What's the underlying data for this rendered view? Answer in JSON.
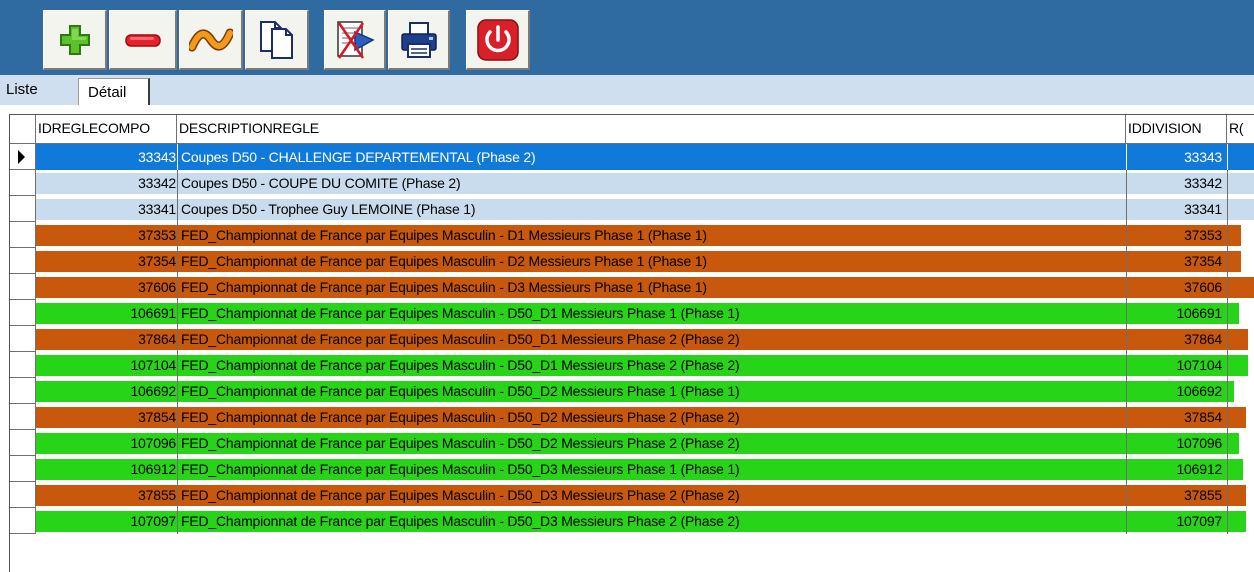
{
  "toolbar": {
    "buttons": [
      {
        "name": "add-button",
        "icon": "plus-icon"
      },
      {
        "name": "remove-button",
        "icon": "minus-icon"
      },
      {
        "name": "edit-button",
        "icon": "wave-icon"
      },
      {
        "name": "copy-button",
        "icon": "copy-pages-icon"
      },
      {
        "name": "export-button",
        "icon": "export-icon"
      },
      {
        "name": "print-button",
        "icon": "printer-icon"
      },
      {
        "name": "quit-button",
        "icon": "power-icon"
      }
    ]
  },
  "tabs": {
    "liste": "Liste",
    "detail": "Détail"
  },
  "grid": {
    "headers": {
      "id": "IDREGLECOMPO",
      "desc": "DESCRIPTIONREGLE",
      "division": "IDDIVISION",
      "extra": "R("
    },
    "rows": [
      {
        "id": "33343",
        "desc": "Coupes D50 - CHALLENGE DEPARTEMENTAL (Phase 2)",
        "division": "33343",
        "status": "selected"
      },
      {
        "id": "33342",
        "desc": "Coupes D50 - COUPE DU COMITE (Phase 2)",
        "division": "33342",
        "status": "none"
      },
      {
        "id": "33341",
        "desc": "Coupes D50 - Trophee Guy LEMOINE (Phase 1)",
        "division": "33341",
        "status": "none"
      },
      {
        "id": "37353",
        "desc": "FED_Championnat de France par Equipes Masculin - D1 Messieurs Phase 1 (Phase 1)",
        "division": "37353",
        "status": "orange"
      },
      {
        "id": "37354",
        "desc": "FED_Championnat de France par Equipes Masculin - D2 Messieurs Phase 1 (Phase 1)",
        "division": "37354",
        "status": "orange"
      },
      {
        "id": "37606",
        "desc": "FED_Championnat de France par Equipes Masculin - D3 Messieurs Phase 1 (Phase 1)",
        "division": "37606",
        "status": "orange"
      },
      {
        "id": "106691",
        "desc": "FED_Championnat de France par Equipes Masculin - D50_D1 Messieurs Phase 1 (Phase 1)",
        "division": "106691",
        "status": "green"
      },
      {
        "id": "37864",
        "desc": "FED_Championnat de France par Equipes Masculin - D50_D1 Messieurs Phase 2 (Phase 2)",
        "division": "37864",
        "status": "orange"
      },
      {
        "id": "107104",
        "desc": "FED_Championnat de France par Equipes Masculin - D50_D1 Messieurs Phase 2 (Phase 2)",
        "division": "107104",
        "status": "green"
      },
      {
        "id": "106692",
        "desc": "FED_Championnat de France par Equipes Masculin - D50_D2 Messieurs Phase 1 (Phase 1)",
        "division": "106692",
        "status": "green"
      },
      {
        "id": "37854",
        "desc": "FED_Championnat de France par Equipes Masculin - D50_D2 Messieurs Phase 2 (Phase 2)",
        "division": "37854",
        "status": "orange"
      },
      {
        "id": "107096",
        "desc": "FED_Championnat de France par Equipes Masculin - D50_D2 Messieurs Phase 2 (Phase 2)",
        "division": "107096",
        "status": "green"
      },
      {
        "id": "106912",
        "desc": "FED_Championnat de France par Equipes Masculin - D50_D3 Messieurs Phase 1 (Phase 1)",
        "division": "106912",
        "status": "green"
      },
      {
        "id": "37855",
        "desc": "FED_Championnat de France par Equipes Masculin - D50_D3 Messieurs Phase 2 (Phase 2)",
        "division": "37855",
        "status": "orange"
      },
      {
        "id": "107097",
        "desc": "FED_Championnat de France par Equipes Masculin - D50_D3 Messieurs Phase 2 (Phase 2)",
        "division": "107097",
        "status": "green"
      }
    ]
  },
  "colors": {
    "toolbar_bg": "#2f6aa0",
    "tab_strip_bg": "#cfdfef",
    "selected_row": "#0f7ad9",
    "plain_row": "#c9dced",
    "orange_row": "#c8580c",
    "green_row": "#28d418"
  }
}
